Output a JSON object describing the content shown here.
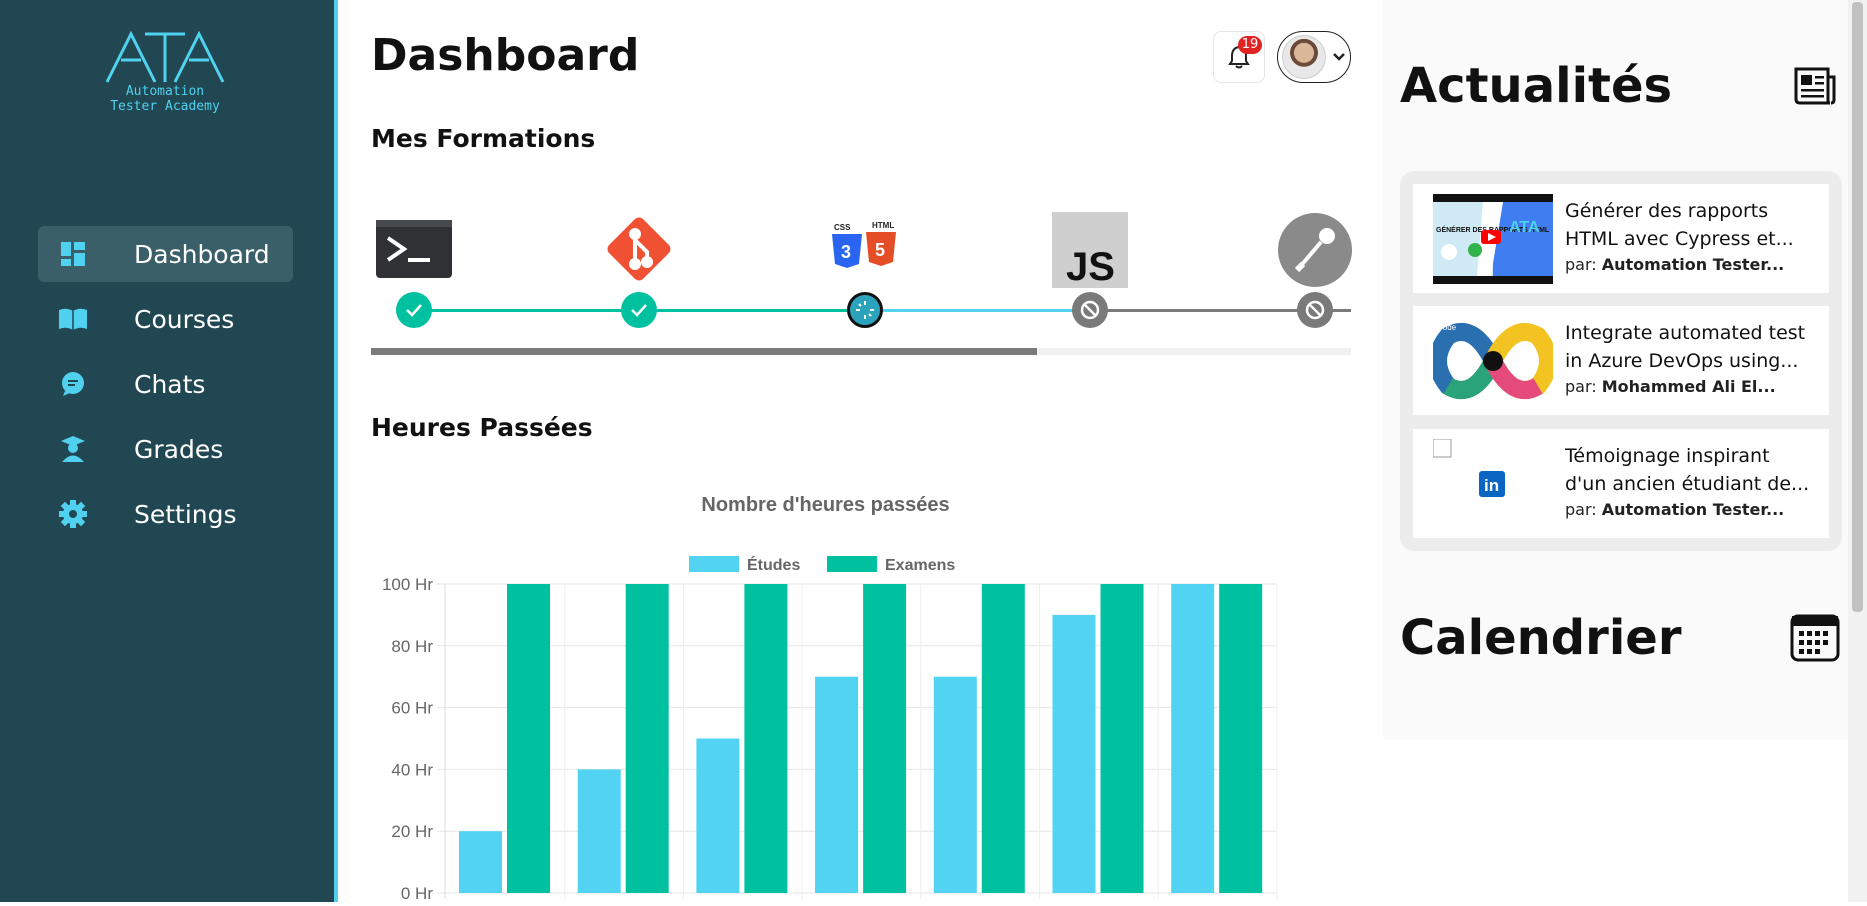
{
  "logo": {
    "line1": "Automation",
    "line2": "Tester Academy"
  },
  "sidebar": {
    "items": [
      {
        "label": "Dashboard",
        "icon": "dashboard-icon",
        "active": true
      },
      {
        "label": "Courses",
        "icon": "book-icon",
        "active": false
      },
      {
        "label": "Chats",
        "icon": "chat-icon",
        "active": false
      },
      {
        "label": "Grades",
        "icon": "graduate-icon",
        "active": false
      },
      {
        "label": "Settings",
        "icon": "gear-icon",
        "active": false
      }
    ]
  },
  "header": {
    "title": "Dashboard",
    "notifications_count": "19"
  },
  "formations": {
    "title": "Mes Formations",
    "progress_fraction": 0.68,
    "courses": [
      {
        "icon": "terminal-icon",
        "status": "completed"
      },
      {
        "icon": "git-icon",
        "status": "completed"
      },
      {
        "icon": "css-html-icon",
        "status": "in-progress"
      },
      {
        "icon": "javascript-icon",
        "status": "locked"
      },
      {
        "icon": "postman-icon",
        "status": "locked"
      }
    ]
  },
  "hours": {
    "title": "Heures Passées"
  },
  "chart_data": {
    "type": "bar",
    "title": "Nombre d'heures passées",
    "legend_position": "top",
    "categories": [
      "",
      "",
      "",
      "",
      "",
      "",
      ""
    ],
    "series": [
      {
        "name": "Études",
        "color": "#52d3f2",
        "values": [
          20,
          40,
          50,
          70,
          70,
          90,
          100
        ]
      },
      {
        "name": "Examens",
        "color": "#00c19f",
        "values": [
          100,
          100,
          100,
          100,
          100,
          100,
          100
        ]
      }
    ],
    "ylim": [
      0,
      100
    ],
    "yticks": [
      "0 Hr",
      "20 Hr",
      "40 Hr",
      "60 Hr",
      "80 Hr",
      "100 Hr"
    ],
    "grid": true
  },
  "news": {
    "title": "Actualités",
    "icon": "newspaper-icon",
    "items": [
      {
        "title": "Générer des rapports HTML avec Cypress et...",
        "by_label": "par:",
        "author": "Automation Tester...",
        "thumb": "video-thumbnail",
        "thumb_text": "GÉNÉRER DES RAPPORTS HTML"
      },
      {
        "title": "Integrate automated test in Azure DevOps using...",
        "by_label": "par:",
        "author": "Mohammed Ali El...",
        "thumb": "devops-loop-thumbnail",
        "thumb_text": "Code"
      },
      {
        "title": "Témoignage inspirant d'un ancien étudiant de...",
        "by_label": "par:",
        "author": "Automation Tester...",
        "thumb": "linkedin-icon",
        "thumb_text": "in"
      }
    ]
  },
  "calendar": {
    "title": "Calendrier",
    "icon": "calendar-icon"
  }
}
